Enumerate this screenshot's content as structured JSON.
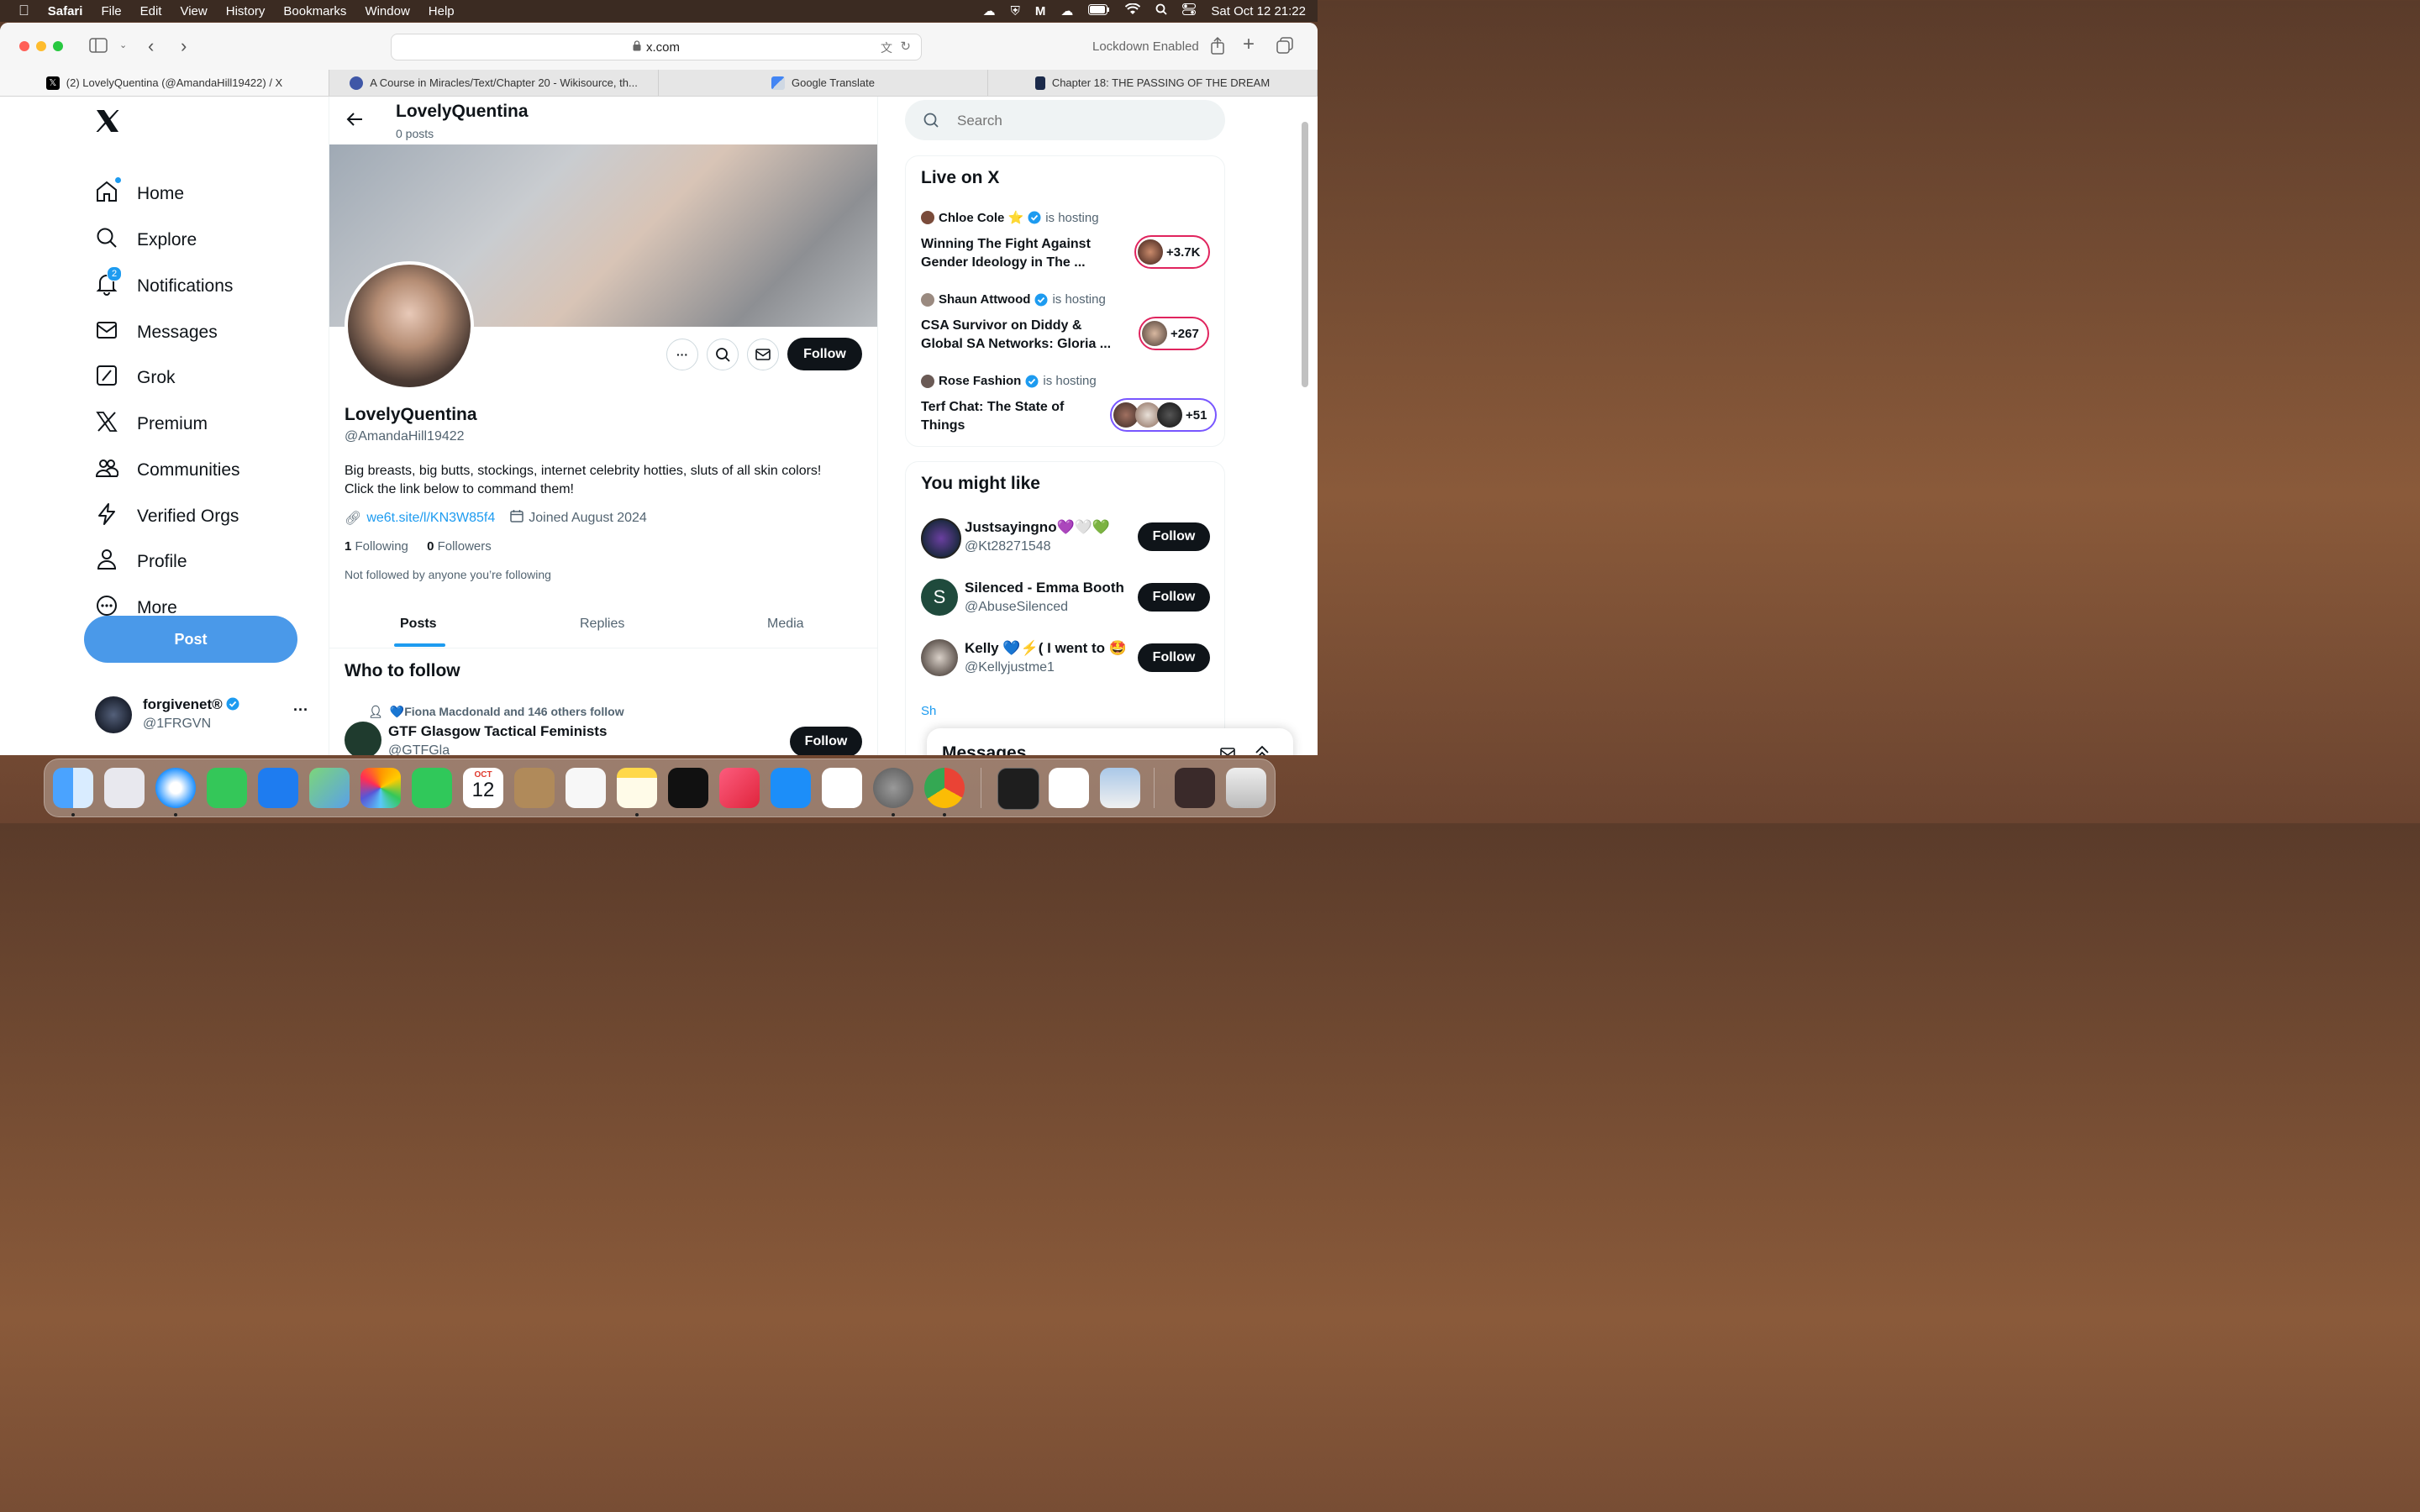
{
  "menubar": {
    "app": "Safari",
    "items": [
      "File",
      "Edit",
      "View",
      "History",
      "Bookmarks",
      "Window",
      "Help"
    ],
    "datetime": "Sat Oct 12  21:22"
  },
  "browser": {
    "url": "x.com",
    "lockdown": "Lockdown Enabled",
    "tabs": [
      {
        "title": "(2) LovelyQuentina (@AmandaHill19422) / X",
        "favicon": "x-icon"
      },
      {
        "title": "A Course in Miracles/Text/Chapter 20 - Wikisource, th...",
        "favicon": "wikisource-icon"
      },
      {
        "title": "Google Translate",
        "favicon": "translate-icon"
      },
      {
        "title": "Chapter 18: THE PASSING OF THE DREAM",
        "favicon": "book-icon"
      }
    ]
  },
  "sidebar": {
    "items": [
      {
        "label": "Home",
        "icon": "home-icon"
      },
      {
        "label": "Explore",
        "icon": "search-icon"
      },
      {
        "label": "Notifications",
        "icon": "bell-icon",
        "badge": "2"
      },
      {
        "label": "Messages",
        "icon": "mail-icon"
      },
      {
        "label": "Grok",
        "icon": "grok-icon"
      },
      {
        "label": "Premium",
        "icon": "x-logo-icon"
      },
      {
        "label": "Communities",
        "icon": "people-icon"
      },
      {
        "label": "Verified Orgs",
        "icon": "bolt-icon"
      },
      {
        "label": "Profile",
        "icon": "person-icon"
      },
      {
        "label": "More",
        "icon": "more-circle-icon"
      }
    ],
    "post_label": "Post",
    "account": {
      "name": "forgivenet®",
      "handle": "@1FRGVN"
    }
  },
  "profile": {
    "header_name": "LovelyQuentina",
    "post_count": "0 posts",
    "name": "LovelyQuentina",
    "handle": "@AmandaHill19422",
    "bio_line1": "Big breasts, big butts, stockings, internet celebrity hotties, sluts of all skin colors!",
    "bio_line2": "Click the link below to command them!",
    "link": "we6t.site/l/KN3W85f4",
    "joined": "Joined August 2024",
    "following_count": "1",
    "following_label": "Following",
    "followers_count": "0",
    "followers_label": "Followers",
    "not_followed": "Not followed by anyone you’re following",
    "follow_label": "Follow",
    "tabs": [
      "Posts",
      "Replies",
      "Media"
    ],
    "who_to_follow": "Who to follow",
    "suggestion": {
      "social_context": "💙Fiona Macdonald and 146 others follow",
      "name": "GTF Glasgow Tactical Feminists",
      "handle": "@GTFGla",
      "follow_label": "Follow"
    }
  },
  "right": {
    "search_placeholder": "Search",
    "live": {
      "title": "Live on X",
      "items": [
        {
          "host": "Chloe Cole ⭐",
          "status": "is hosting",
          "title_line1": "Winning The Fight Against",
          "title_line2": "Gender Ideology in The ...",
          "count": "+3.7K",
          "pill_color": "#e0245e"
        },
        {
          "host": "Shaun Attwood",
          "status": "is hosting",
          "title_line1": "CSA Survivor on Diddy &",
          "title_line2": "Global SA Networks: Gloria ...",
          "count": "+267",
          "pill_color": "#e0245e"
        },
        {
          "host": "Rose Fashion",
          "status": "is hosting",
          "title_line1": "Terf Chat: The State of",
          "title_line2": "Things",
          "count": "+51",
          "pill_color": "#7856ff"
        }
      ]
    },
    "might_like": {
      "title": "You might like",
      "items": [
        {
          "name": "Justsayingno💜🤍💚",
          "handle": "@Kt28271548",
          "follow": "Follow"
        },
        {
          "name": "Silenced - Emma Booth",
          "handle": "@AbuseSilenced",
          "follow": "Follow",
          "initial": "S"
        },
        {
          "name": "Kelly 💙⚡( I went to 🤩",
          "handle": "@Kellyjustme1",
          "follow": "Follow"
        }
      ],
      "show_more": "Sh"
    },
    "messages_title": "Messages"
  },
  "colors": {
    "accent": "#1d9bf0",
    "post_button": "#4a99e9",
    "dark": "#0f1419",
    "live_pink": "#e0245e",
    "live_purple": "#7856ff"
  },
  "dock": {
    "calendar_month": "OCT",
    "calendar_day": "12"
  }
}
